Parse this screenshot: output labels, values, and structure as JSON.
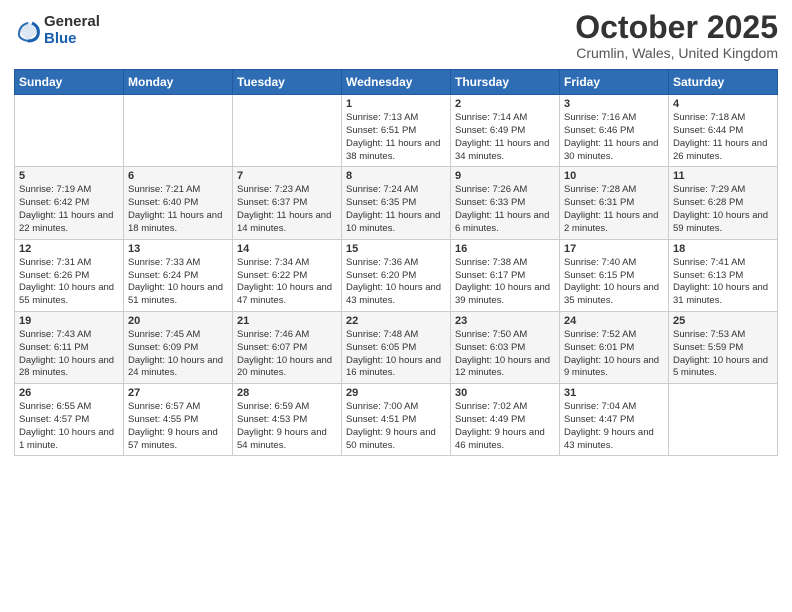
{
  "logo": {
    "general": "General",
    "blue": "Blue"
  },
  "header": {
    "month": "October 2025",
    "location": "Crumlin, Wales, United Kingdom"
  },
  "weekdays": [
    "Sunday",
    "Monday",
    "Tuesday",
    "Wednesday",
    "Thursday",
    "Friday",
    "Saturday"
  ],
  "weeks": [
    [
      {
        "day": "",
        "info": ""
      },
      {
        "day": "",
        "info": ""
      },
      {
        "day": "",
        "info": ""
      },
      {
        "day": "1",
        "info": "Sunrise: 7:13 AM\nSunset: 6:51 PM\nDaylight: 11 hours\nand 38 minutes."
      },
      {
        "day": "2",
        "info": "Sunrise: 7:14 AM\nSunset: 6:49 PM\nDaylight: 11 hours\nand 34 minutes."
      },
      {
        "day": "3",
        "info": "Sunrise: 7:16 AM\nSunset: 6:46 PM\nDaylight: 11 hours\nand 30 minutes."
      },
      {
        "day": "4",
        "info": "Sunrise: 7:18 AM\nSunset: 6:44 PM\nDaylight: 11 hours\nand 26 minutes."
      }
    ],
    [
      {
        "day": "5",
        "info": "Sunrise: 7:19 AM\nSunset: 6:42 PM\nDaylight: 11 hours\nand 22 minutes."
      },
      {
        "day": "6",
        "info": "Sunrise: 7:21 AM\nSunset: 6:40 PM\nDaylight: 11 hours\nand 18 minutes."
      },
      {
        "day": "7",
        "info": "Sunrise: 7:23 AM\nSunset: 6:37 PM\nDaylight: 11 hours\nand 14 minutes."
      },
      {
        "day": "8",
        "info": "Sunrise: 7:24 AM\nSunset: 6:35 PM\nDaylight: 11 hours\nand 10 minutes."
      },
      {
        "day": "9",
        "info": "Sunrise: 7:26 AM\nSunset: 6:33 PM\nDaylight: 11 hours\nand 6 minutes."
      },
      {
        "day": "10",
        "info": "Sunrise: 7:28 AM\nSunset: 6:31 PM\nDaylight: 11 hours\nand 2 minutes."
      },
      {
        "day": "11",
        "info": "Sunrise: 7:29 AM\nSunset: 6:28 PM\nDaylight: 10 hours\nand 59 minutes."
      }
    ],
    [
      {
        "day": "12",
        "info": "Sunrise: 7:31 AM\nSunset: 6:26 PM\nDaylight: 10 hours\nand 55 minutes."
      },
      {
        "day": "13",
        "info": "Sunrise: 7:33 AM\nSunset: 6:24 PM\nDaylight: 10 hours\nand 51 minutes."
      },
      {
        "day": "14",
        "info": "Sunrise: 7:34 AM\nSunset: 6:22 PM\nDaylight: 10 hours\nand 47 minutes."
      },
      {
        "day": "15",
        "info": "Sunrise: 7:36 AM\nSunset: 6:20 PM\nDaylight: 10 hours\nand 43 minutes."
      },
      {
        "day": "16",
        "info": "Sunrise: 7:38 AM\nSunset: 6:17 PM\nDaylight: 10 hours\nand 39 minutes."
      },
      {
        "day": "17",
        "info": "Sunrise: 7:40 AM\nSunset: 6:15 PM\nDaylight: 10 hours\nand 35 minutes."
      },
      {
        "day": "18",
        "info": "Sunrise: 7:41 AM\nSunset: 6:13 PM\nDaylight: 10 hours\nand 31 minutes."
      }
    ],
    [
      {
        "day": "19",
        "info": "Sunrise: 7:43 AM\nSunset: 6:11 PM\nDaylight: 10 hours\nand 28 minutes."
      },
      {
        "day": "20",
        "info": "Sunrise: 7:45 AM\nSunset: 6:09 PM\nDaylight: 10 hours\nand 24 minutes."
      },
      {
        "day": "21",
        "info": "Sunrise: 7:46 AM\nSunset: 6:07 PM\nDaylight: 10 hours\nand 20 minutes."
      },
      {
        "day": "22",
        "info": "Sunrise: 7:48 AM\nSunset: 6:05 PM\nDaylight: 10 hours\nand 16 minutes."
      },
      {
        "day": "23",
        "info": "Sunrise: 7:50 AM\nSunset: 6:03 PM\nDaylight: 10 hours\nand 12 minutes."
      },
      {
        "day": "24",
        "info": "Sunrise: 7:52 AM\nSunset: 6:01 PM\nDaylight: 10 hours\nand 9 minutes."
      },
      {
        "day": "25",
        "info": "Sunrise: 7:53 AM\nSunset: 5:59 PM\nDaylight: 10 hours\nand 5 minutes."
      }
    ],
    [
      {
        "day": "26",
        "info": "Sunrise: 6:55 AM\nSunset: 4:57 PM\nDaylight: 10 hours\nand 1 minute."
      },
      {
        "day": "27",
        "info": "Sunrise: 6:57 AM\nSunset: 4:55 PM\nDaylight: 9 hours\nand 57 minutes."
      },
      {
        "day": "28",
        "info": "Sunrise: 6:59 AM\nSunset: 4:53 PM\nDaylight: 9 hours\nand 54 minutes."
      },
      {
        "day": "29",
        "info": "Sunrise: 7:00 AM\nSunset: 4:51 PM\nDaylight: 9 hours\nand 50 minutes."
      },
      {
        "day": "30",
        "info": "Sunrise: 7:02 AM\nSunset: 4:49 PM\nDaylight: 9 hours\nand 46 minutes."
      },
      {
        "day": "31",
        "info": "Sunrise: 7:04 AM\nSunset: 4:47 PM\nDaylight: 9 hours\nand 43 minutes."
      },
      {
        "day": "",
        "info": ""
      }
    ]
  ]
}
